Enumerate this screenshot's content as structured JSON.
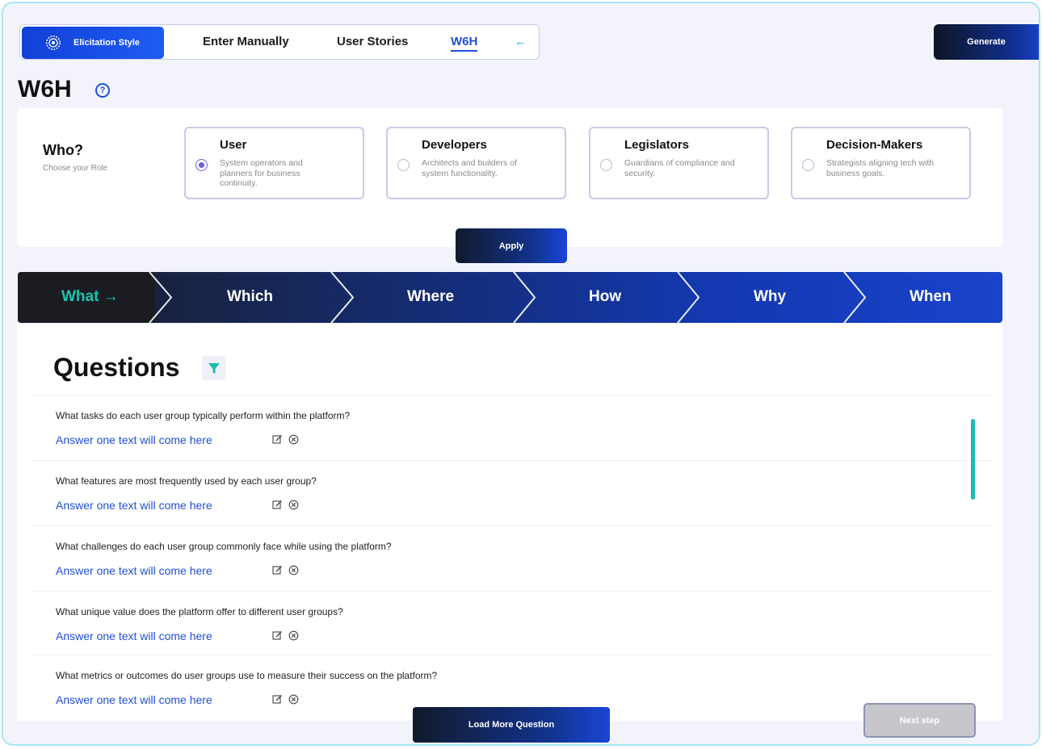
{
  "header": {
    "elicitation_style_label": "Elicitation Style",
    "tabs": [
      {
        "label": "Enter Manually",
        "active": false
      },
      {
        "label": "User Stories",
        "active": false
      },
      {
        "label": "W6H",
        "active": true
      }
    ],
    "generate_label": "Generate"
  },
  "page_title": "W6H",
  "who": {
    "title": "Who?",
    "subtitle": "Choose your Role",
    "roles": [
      {
        "title": "User",
        "description": "System operators and planners for business continuity.",
        "selected": true
      },
      {
        "title": "Developers",
        "description": "Architects and builders of system functionality.",
        "selected": false
      },
      {
        "title": "Legislators",
        "description": "Guardians of compliance and security.",
        "selected": false
      },
      {
        "title": "Decision-Makers",
        "description": "Strategists aligning tech with business goals.",
        "selected": false
      }
    ],
    "apply_label": "Apply"
  },
  "steps": [
    {
      "label": "What →",
      "active": true
    },
    {
      "label": "Which",
      "active": false
    },
    {
      "label": "Where",
      "active": false
    },
    {
      "label": "How",
      "active": false
    },
    {
      "label": "Why",
      "active": false
    },
    {
      "label": "When",
      "active": false
    }
  ],
  "questions": {
    "title": "Questions",
    "items": [
      {
        "question": "What tasks do each user group typically perform within the platform?",
        "answer": "Answer one text will come here"
      },
      {
        "question": "What features are most frequently used by each user group?",
        "answer": "Answer one text will come here"
      },
      {
        "question": "What challenges do each user group commonly face while using the platform?",
        "answer": "Answer one text will come here"
      },
      {
        "question": "What unique value does the platform offer to different user groups?",
        "answer": "Answer one text will come here"
      },
      {
        "question": "What metrics or outcomes do user groups use to measure their success on the platform?",
        "answer": "Answer one text will come here"
      }
    ],
    "load_more_label": "Load More Question",
    "next_step_label": "Next step"
  },
  "colors": {
    "accent_blue": "#1f4fd8",
    "accent_teal": "#16c6b3",
    "step_dark": "#1a1c22",
    "step_blue": "#1640c4"
  },
  "icons": [
    "gear-icon",
    "help-icon",
    "back-arrow-icon",
    "filter-icon",
    "edit-icon",
    "delete-icon",
    "radio-icon"
  ]
}
